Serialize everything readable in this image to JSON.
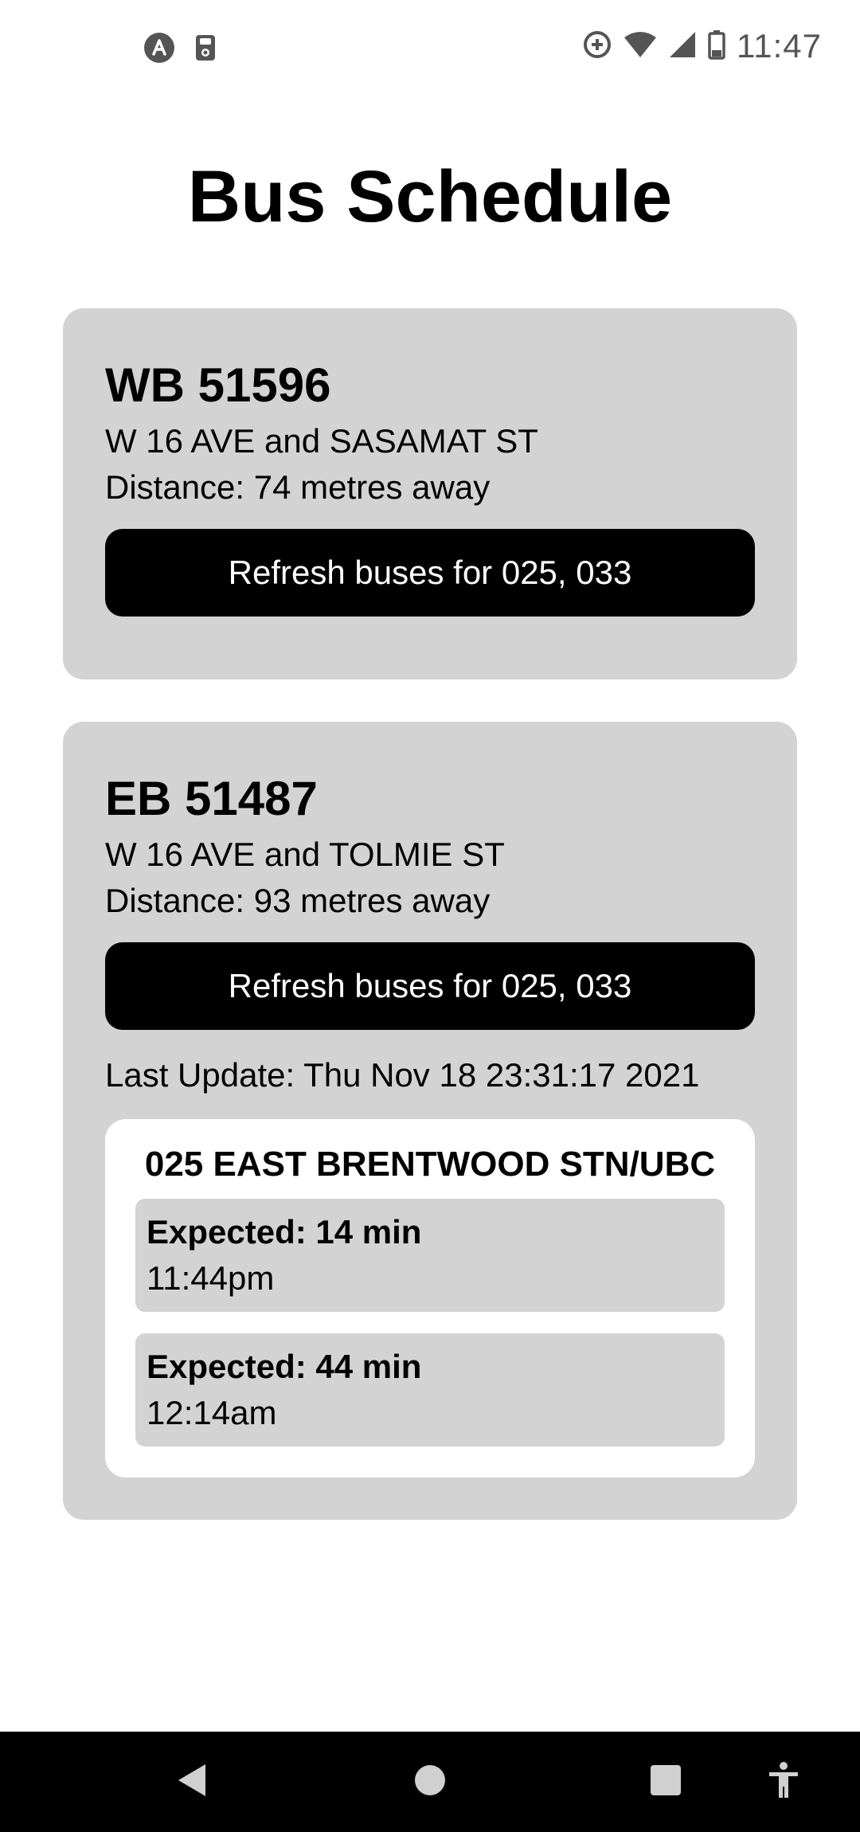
{
  "status_bar": {
    "time": "11:47",
    "left_icons": [
      "app-icon",
      "sd-card-icon"
    ],
    "right_icons": [
      "data-saver-icon",
      "wifi-icon",
      "signal-icon",
      "battery-icon"
    ]
  },
  "page": {
    "title": "Bus Schedule"
  },
  "stops": [
    {
      "code": "WB 51596",
      "name": "W 16 AVE and SASAMAT ST",
      "distance": "Distance: 74 metres away",
      "refresh_label": "Refresh buses for 025, 033"
    },
    {
      "code": "EB 51487",
      "name": "W 16 AVE and TOLMIE ST",
      "distance": "Distance: 93 metres away",
      "refresh_label": "Refresh buses for 025, 033",
      "last_update": "Last Update: Thu Nov 18 23:31:17 2021",
      "route": {
        "title": "025 EAST BRENTWOOD STN/UBC",
        "arrivals": [
          {
            "expected": "Expected: 14 min",
            "time": "11:44pm"
          },
          {
            "expected": "Expected: 44 min",
            "time": "12:14am"
          }
        ]
      }
    }
  ],
  "nav_bar": {
    "buttons": [
      "back-icon",
      "home-icon",
      "recents-icon",
      "accessibility-icon"
    ]
  },
  "colors": {
    "card_background": "#d3d3d3",
    "button_background": "#000000",
    "button_text": "#ffffff",
    "page_background": "#ffffff"
  }
}
